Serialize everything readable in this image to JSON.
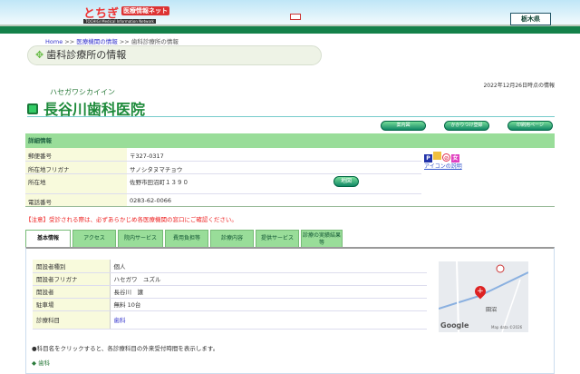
{
  "header": {
    "logo_text": "とちぎ医療情報ネット",
    "logo_sub": "TOCHIGI Medical Information Network",
    "pref_label": "栃木県"
  },
  "breadcrumb": {
    "home": "Home",
    "sep": ">>",
    "level1": "医療機関の情報",
    "current": "歯科診療所の情報"
  },
  "page_title": "歯科診療所の情報",
  "as_of": "2022年12月26日時点の情報",
  "clinic": {
    "kana": "ハセガワシカイイン",
    "name": "長谷川歯科医院"
  },
  "buttons": {
    "guide_map": "案内図",
    "register": "かかりつけ登録",
    "print": "印刷用ページ",
    "map": "地図"
  },
  "details": {
    "header": "詳細情報",
    "rows": [
      {
        "label": "郵便番号",
        "value": "〒327-0317"
      },
      {
        "label": "所在地フリガナ",
        "value": "サノシタヌマチョウ"
      },
      {
        "label": "所在地",
        "value": "佐野市田沼町１３９０"
      },
      {
        "label": "電話番号",
        "value": "0283-62-0066"
      }
    ],
    "icons": [
      {
        "name": "parking-icon",
        "label": "P",
        "color": "#2233aa"
      },
      {
        "name": "barrier-free-icon",
        "label": "",
        "color": "#f0c040"
      },
      {
        "name": "no-smoking-icon",
        "label": "⊘",
        "color": "#e03050"
      },
      {
        "name": "women-icon",
        "label": "女",
        "color": "#e040c0"
      }
    ],
    "icon_help": "アイコンの説明"
  },
  "warning": "【注意】受診される際は、必ずあらかじめ各医療機関の窓口にご確認ください。",
  "tabs": [
    "基本情報",
    "アクセス",
    "院内サービス",
    "費用負担等",
    "診療内容",
    "提供サービス",
    "診療の実績結果等"
  ],
  "basic": {
    "rows": [
      {
        "label": "開設者種別",
        "value": "個人"
      },
      {
        "label": "開設者フリガナ",
        "value": "ハセガワ　ユズル"
      },
      {
        "label": "開設者",
        "value": "長谷川　譲"
      },
      {
        "label": "駐車場",
        "value": "無料 10台"
      },
      {
        "label": "診療科目",
        "value": "歯科"
      }
    ]
  },
  "map": {
    "place": "田沼",
    "attribution": "Map data ©2026",
    "brand": "Google"
  },
  "note": "●科目名をクリックすると、各診療科目の外来受付時間を表示します。",
  "bottom_heading": "歯科"
}
